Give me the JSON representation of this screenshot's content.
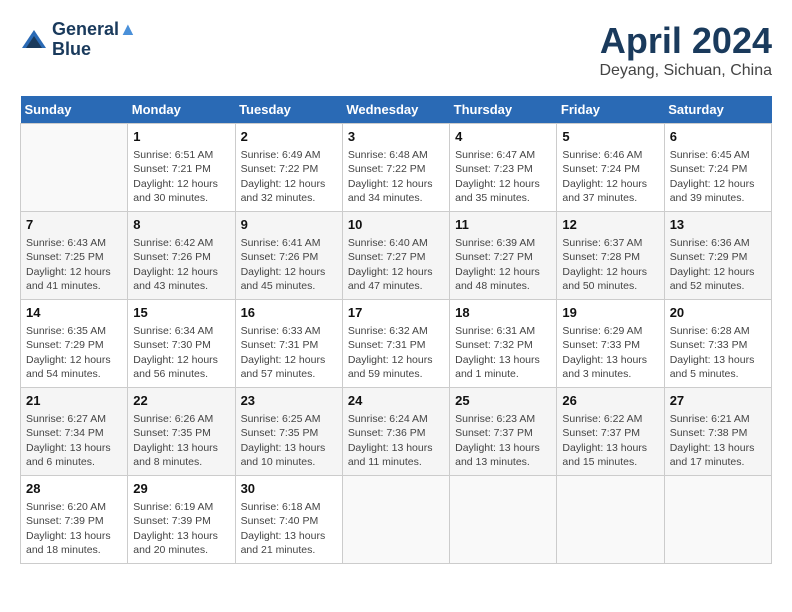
{
  "logo": {
    "line1": "General",
    "line2": "Blue"
  },
  "title": "April 2024",
  "subtitle": "Deyang, Sichuan, China",
  "weekdays": [
    "Sunday",
    "Monday",
    "Tuesday",
    "Wednesday",
    "Thursday",
    "Friday",
    "Saturday"
  ],
  "weeks": [
    [
      {
        "day": "",
        "info": ""
      },
      {
        "day": "1",
        "info": "Sunrise: 6:51 AM\nSunset: 7:21 PM\nDaylight: 12 hours\nand 30 minutes."
      },
      {
        "day": "2",
        "info": "Sunrise: 6:49 AM\nSunset: 7:22 PM\nDaylight: 12 hours\nand 32 minutes."
      },
      {
        "day": "3",
        "info": "Sunrise: 6:48 AM\nSunset: 7:22 PM\nDaylight: 12 hours\nand 34 minutes."
      },
      {
        "day": "4",
        "info": "Sunrise: 6:47 AM\nSunset: 7:23 PM\nDaylight: 12 hours\nand 35 minutes."
      },
      {
        "day": "5",
        "info": "Sunrise: 6:46 AM\nSunset: 7:24 PM\nDaylight: 12 hours\nand 37 minutes."
      },
      {
        "day": "6",
        "info": "Sunrise: 6:45 AM\nSunset: 7:24 PM\nDaylight: 12 hours\nand 39 minutes."
      }
    ],
    [
      {
        "day": "7",
        "info": "Sunrise: 6:43 AM\nSunset: 7:25 PM\nDaylight: 12 hours\nand 41 minutes."
      },
      {
        "day": "8",
        "info": "Sunrise: 6:42 AM\nSunset: 7:26 PM\nDaylight: 12 hours\nand 43 minutes."
      },
      {
        "day": "9",
        "info": "Sunrise: 6:41 AM\nSunset: 7:26 PM\nDaylight: 12 hours\nand 45 minutes."
      },
      {
        "day": "10",
        "info": "Sunrise: 6:40 AM\nSunset: 7:27 PM\nDaylight: 12 hours\nand 47 minutes."
      },
      {
        "day": "11",
        "info": "Sunrise: 6:39 AM\nSunset: 7:27 PM\nDaylight: 12 hours\nand 48 minutes."
      },
      {
        "day": "12",
        "info": "Sunrise: 6:37 AM\nSunset: 7:28 PM\nDaylight: 12 hours\nand 50 minutes."
      },
      {
        "day": "13",
        "info": "Sunrise: 6:36 AM\nSunset: 7:29 PM\nDaylight: 12 hours\nand 52 minutes."
      }
    ],
    [
      {
        "day": "14",
        "info": "Sunrise: 6:35 AM\nSunset: 7:29 PM\nDaylight: 12 hours\nand 54 minutes."
      },
      {
        "day": "15",
        "info": "Sunrise: 6:34 AM\nSunset: 7:30 PM\nDaylight: 12 hours\nand 56 minutes."
      },
      {
        "day": "16",
        "info": "Sunrise: 6:33 AM\nSunset: 7:31 PM\nDaylight: 12 hours\nand 57 minutes."
      },
      {
        "day": "17",
        "info": "Sunrise: 6:32 AM\nSunset: 7:31 PM\nDaylight: 12 hours\nand 59 minutes."
      },
      {
        "day": "18",
        "info": "Sunrise: 6:31 AM\nSunset: 7:32 PM\nDaylight: 13 hours\nand 1 minute."
      },
      {
        "day": "19",
        "info": "Sunrise: 6:29 AM\nSunset: 7:33 PM\nDaylight: 13 hours\nand 3 minutes."
      },
      {
        "day": "20",
        "info": "Sunrise: 6:28 AM\nSunset: 7:33 PM\nDaylight: 13 hours\nand 5 minutes."
      }
    ],
    [
      {
        "day": "21",
        "info": "Sunrise: 6:27 AM\nSunset: 7:34 PM\nDaylight: 13 hours\nand 6 minutes."
      },
      {
        "day": "22",
        "info": "Sunrise: 6:26 AM\nSunset: 7:35 PM\nDaylight: 13 hours\nand 8 minutes."
      },
      {
        "day": "23",
        "info": "Sunrise: 6:25 AM\nSunset: 7:35 PM\nDaylight: 13 hours\nand 10 minutes."
      },
      {
        "day": "24",
        "info": "Sunrise: 6:24 AM\nSunset: 7:36 PM\nDaylight: 13 hours\nand 11 minutes."
      },
      {
        "day": "25",
        "info": "Sunrise: 6:23 AM\nSunset: 7:37 PM\nDaylight: 13 hours\nand 13 minutes."
      },
      {
        "day": "26",
        "info": "Sunrise: 6:22 AM\nSunset: 7:37 PM\nDaylight: 13 hours\nand 15 minutes."
      },
      {
        "day": "27",
        "info": "Sunrise: 6:21 AM\nSunset: 7:38 PM\nDaylight: 13 hours\nand 17 minutes."
      }
    ],
    [
      {
        "day": "28",
        "info": "Sunrise: 6:20 AM\nSunset: 7:39 PM\nDaylight: 13 hours\nand 18 minutes."
      },
      {
        "day": "29",
        "info": "Sunrise: 6:19 AM\nSunset: 7:39 PM\nDaylight: 13 hours\nand 20 minutes."
      },
      {
        "day": "30",
        "info": "Sunrise: 6:18 AM\nSunset: 7:40 PM\nDaylight: 13 hours\nand 21 minutes."
      },
      {
        "day": "",
        "info": ""
      },
      {
        "day": "",
        "info": ""
      },
      {
        "day": "",
        "info": ""
      },
      {
        "day": "",
        "info": ""
      }
    ]
  ]
}
